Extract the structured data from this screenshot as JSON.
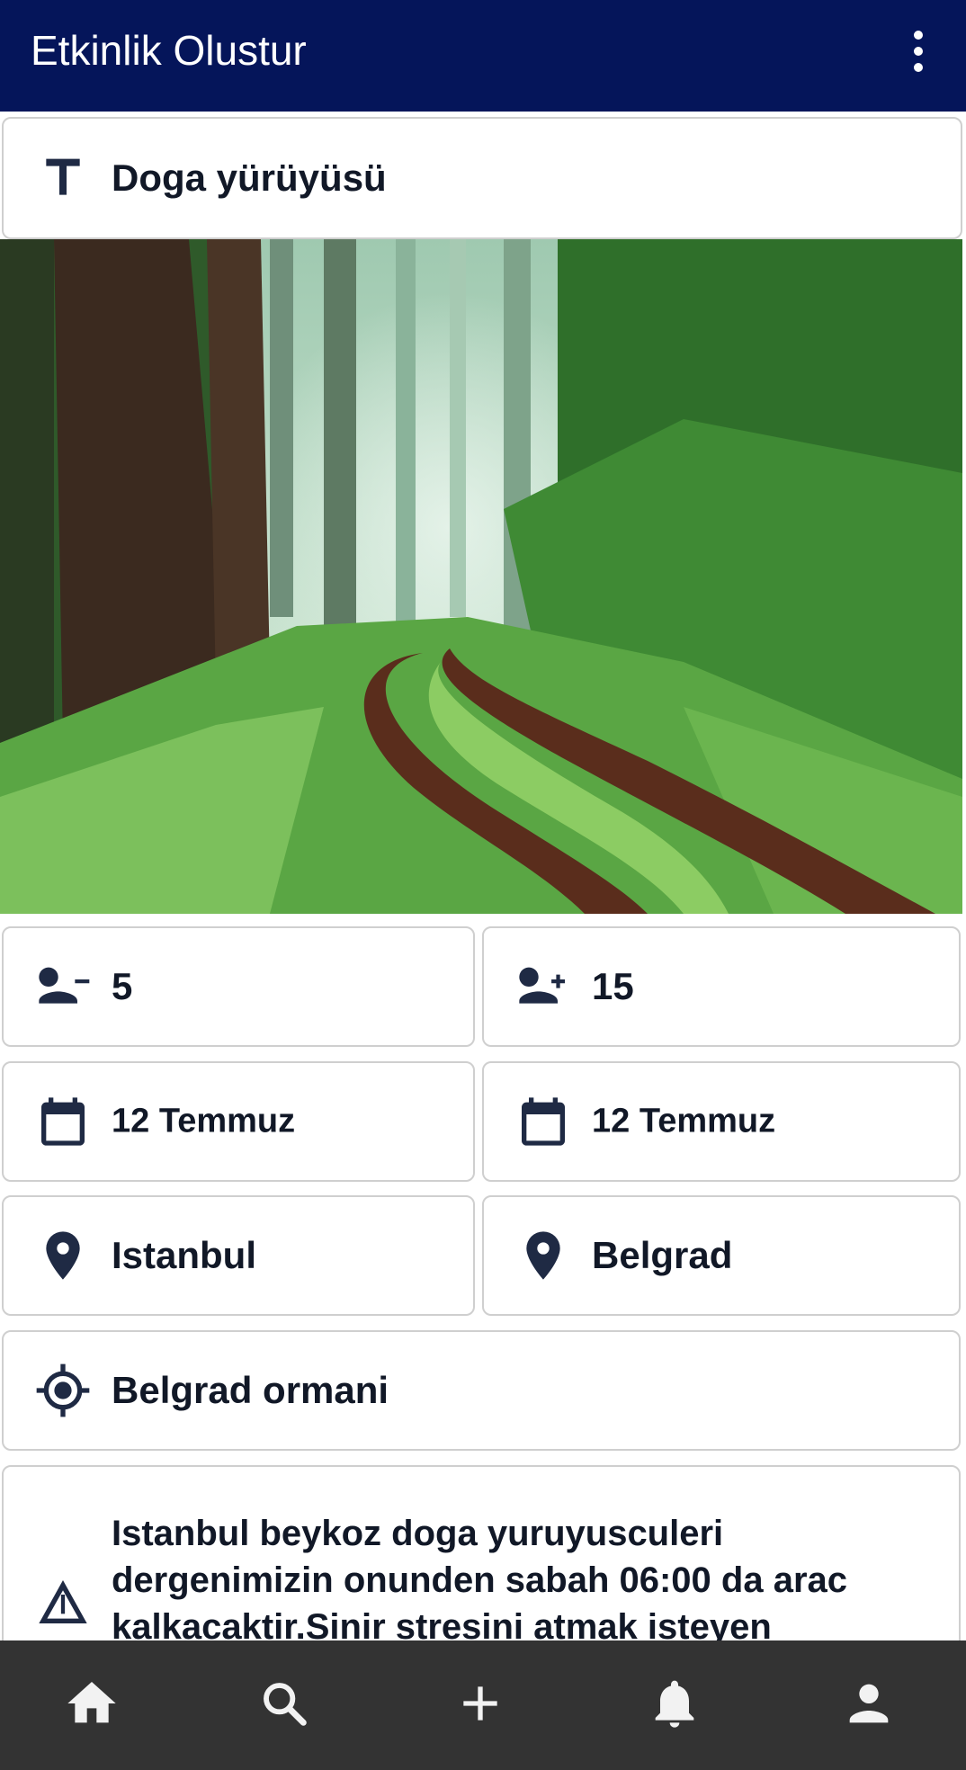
{
  "appbar": {
    "title": "Etkinlik Olustur",
    "menu_icon": "more-vert-icon"
  },
  "event": {
    "name": "Doga yürüyüsü",
    "name_icon": "text-title-icon",
    "image_description_icon": "forest-path-photo"
  },
  "participants": {
    "min": "5",
    "min_icon": "person-remove-icon",
    "max": "15",
    "max_icon": "person-add-icon"
  },
  "dates": {
    "start": "12 Temmuz",
    "end": "12 Temmuz",
    "icon": "calendar-icon"
  },
  "locations": {
    "city": "Istanbul",
    "district": "Belgrad",
    "icon": "location-pin-icon"
  },
  "meeting_point": {
    "value": "Belgrad ormani",
    "icon": "my-location-icon"
  },
  "description": {
    "text": "Istanbul beykoz doga yuruyusculeri dergenimizin onunden  sabah 06:00 da arac kalkacaktir.Sinir stresini atmak isteyen",
    "icon": "warning-outline-icon"
  },
  "bottom_nav": [
    {
      "icon": "home-icon"
    },
    {
      "icon": "search-icon"
    },
    {
      "icon": "add-icon"
    },
    {
      "icon": "notifications-icon"
    },
    {
      "icon": "account-icon"
    }
  ],
  "colors": {
    "appbar": "#05155a",
    "bottom_bar": "#333333",
    "icon_dark": "#1f2a44",
    "field_border": "#cfcfcf"
  }
}
